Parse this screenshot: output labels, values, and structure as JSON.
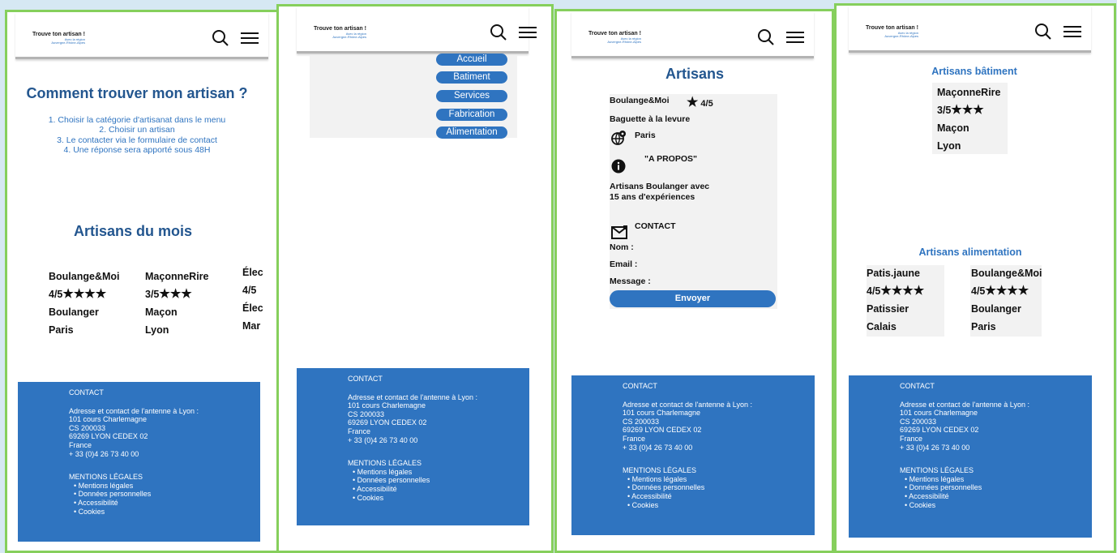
{
  "header": {
    "logo_title": "Trouve ton artisan !",
    "logo_sub1": "Avec la région",
    "logo_sub2": "Auvergne-Rhône-Alpes",
    "icons": [
      "search-icon",
      "menu-icon"
    ]
  },
  "home": {
    "title": "Comment trouver mon artisan ?",
    "steps": [
      "1. Choisir la catégorie d'artisanat dans le menu",
      "2. Choisir un artisan",
      "3. Le contacter via le formulaire de contact",
      "4. Une réponse sera apporté sous 48H"
    ],
    "section_title": "Artisans du mois",
    "cards": [
      {
        "name": "Boulange&Moi",
        "rating": "4/5",
        "stars": "★★★★",
        "trade": "Boulanger",
        "city": "Paris"
      },
      {
        "name": "MaçonneRire",
        "rating": "3/5",
        "stars": "★★★",
        "trade": "Maçon",
        "city": "Lyon"
      },
      {
        "name": "Élec",
        "rating": "4/5",
        "stars": "",
        "trade": "Élec",
        "city": "Mar"
      }
    ]
  },
  "menu": {
    "items": [
      "Accueil",
      "Batiment",
      "Services",
      "Fabrication",
      "Alimentation"
    ]
  },
  "artisan": {
    "title": "Artisans",
    "name": "Boulange&Moi",
    "rating": "4/5",
    "product": "Baguette à la levure",
    "city": "Paris",
    "about_label": "\"A PROPOS\"",
    "about_line1": "Artisans Boulanger avec",
    "about_line2": "15 ans d'expériences",
    "contact_label": "CONTACT",
    "name_label": "Nom :",
    "email_label": "Email :",
    "message_label": "Message :",
    "send_label": "Envoyer"
  },
  "category": {
    "building_title": "Artisans bâtiment",
    "building_card": {
      "name": "MaçonneRire",
      "rating": "3/5",
      "stars": "★★★",
      "trade": "Maçon",
      "city": "Lyon"
    },
    "food_title": "Artisans alimentation",
    "food_cards": [
      {
        "name": "Patis.jaune",
        "rating": "4/5",
        "stars": "★★★★",
        "trade": "Patissier",
        "city": "Calais"
      },
      {
        "name": "Boulange&Moi",
        "rating": "4/5",
        "stars": "★★★★",
        "trade": "Boulanger",
        "city": "Paris"
      }
    ]
  },
  "footer": {
    "contact_title": "CONTACT",
    "address_intro": "Adresse et contact de l'antenne à Lyon :",
    "address_lines": [
      "101 cours Charlemagne",
      "CS 200033",
      "69269 LYON CEDEX 02",
      "France",
      "+ 33 (0)4 26 73 40 00"
    ],
    "legal_title": "MENTIONS LÉGALES",
    "legal_links": [
      "Mentions légales",
      "Données personnelles",
      "Accessibilité",
      "Cookies"
    ]
  }
}
